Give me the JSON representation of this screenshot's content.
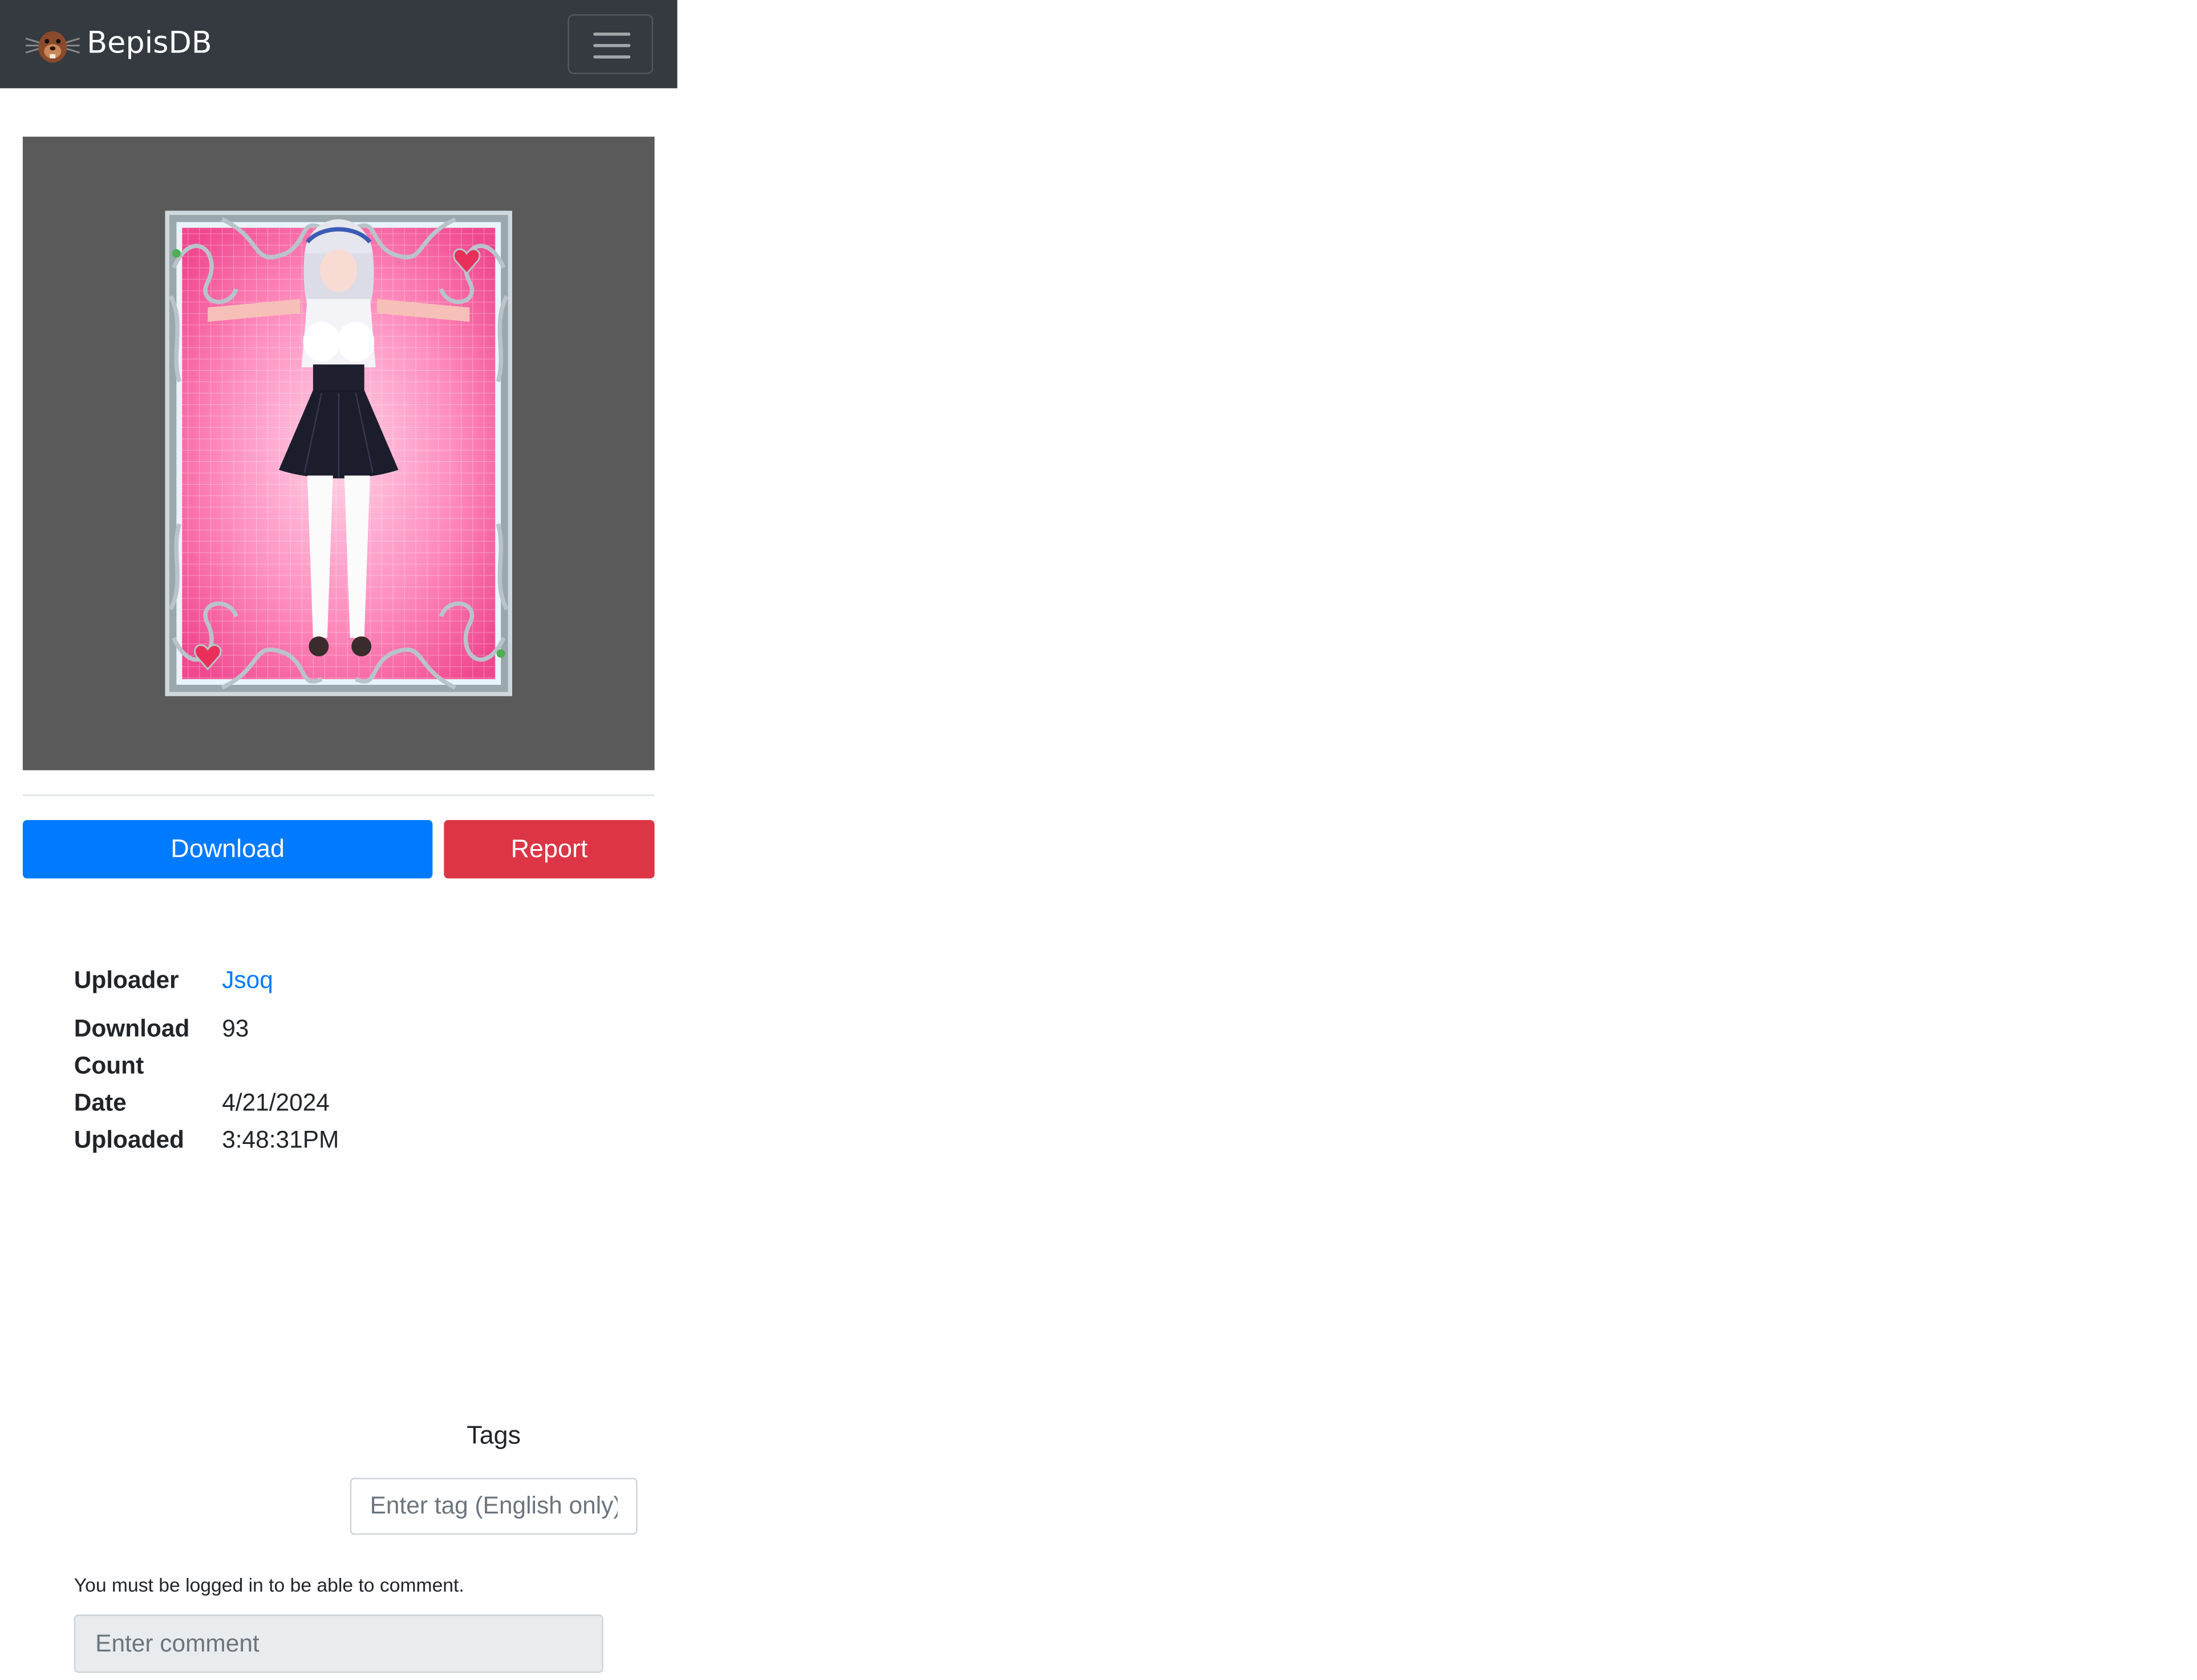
{
  "navbar": {
    "brand": "BepisDB",
    "logo_icon": "bepis-logo-icon",
    "toggler_icon": "hamburger-menu-icon",
    "background": "#343a40"
  },
  "card": {
    "image_icon": "character-card-image",
    "background": "#5a5a5a"
  },
  "actions": {
    "download_label": "Download",
    "report_label": "Report",
    "download_color": "#007bff",
    "report_color": "#dc3545"
  },
  "info": {
    "uploader_label": "Uploader",
    "uploader_value": "Jsoq",
    "download_count_label_line1": "Download",
    "download_count_label_line2": "Count",
    "download_count_value": "93",
    "date_label_line1": "Date",
    "date_label_line2": "Uploaded",
    "date_value_line1": "4/21/2024",
    "date_value_line2": "3:48:31PM"
  },
  "tags": {
    "heading": "Tags",
    "placeholder": "Enter tag (English only)"
  },
  "comments": {
    "login_note": "You must be logged in to be able to comment.",
    "placeholder": "Enter comment"
  }
}
